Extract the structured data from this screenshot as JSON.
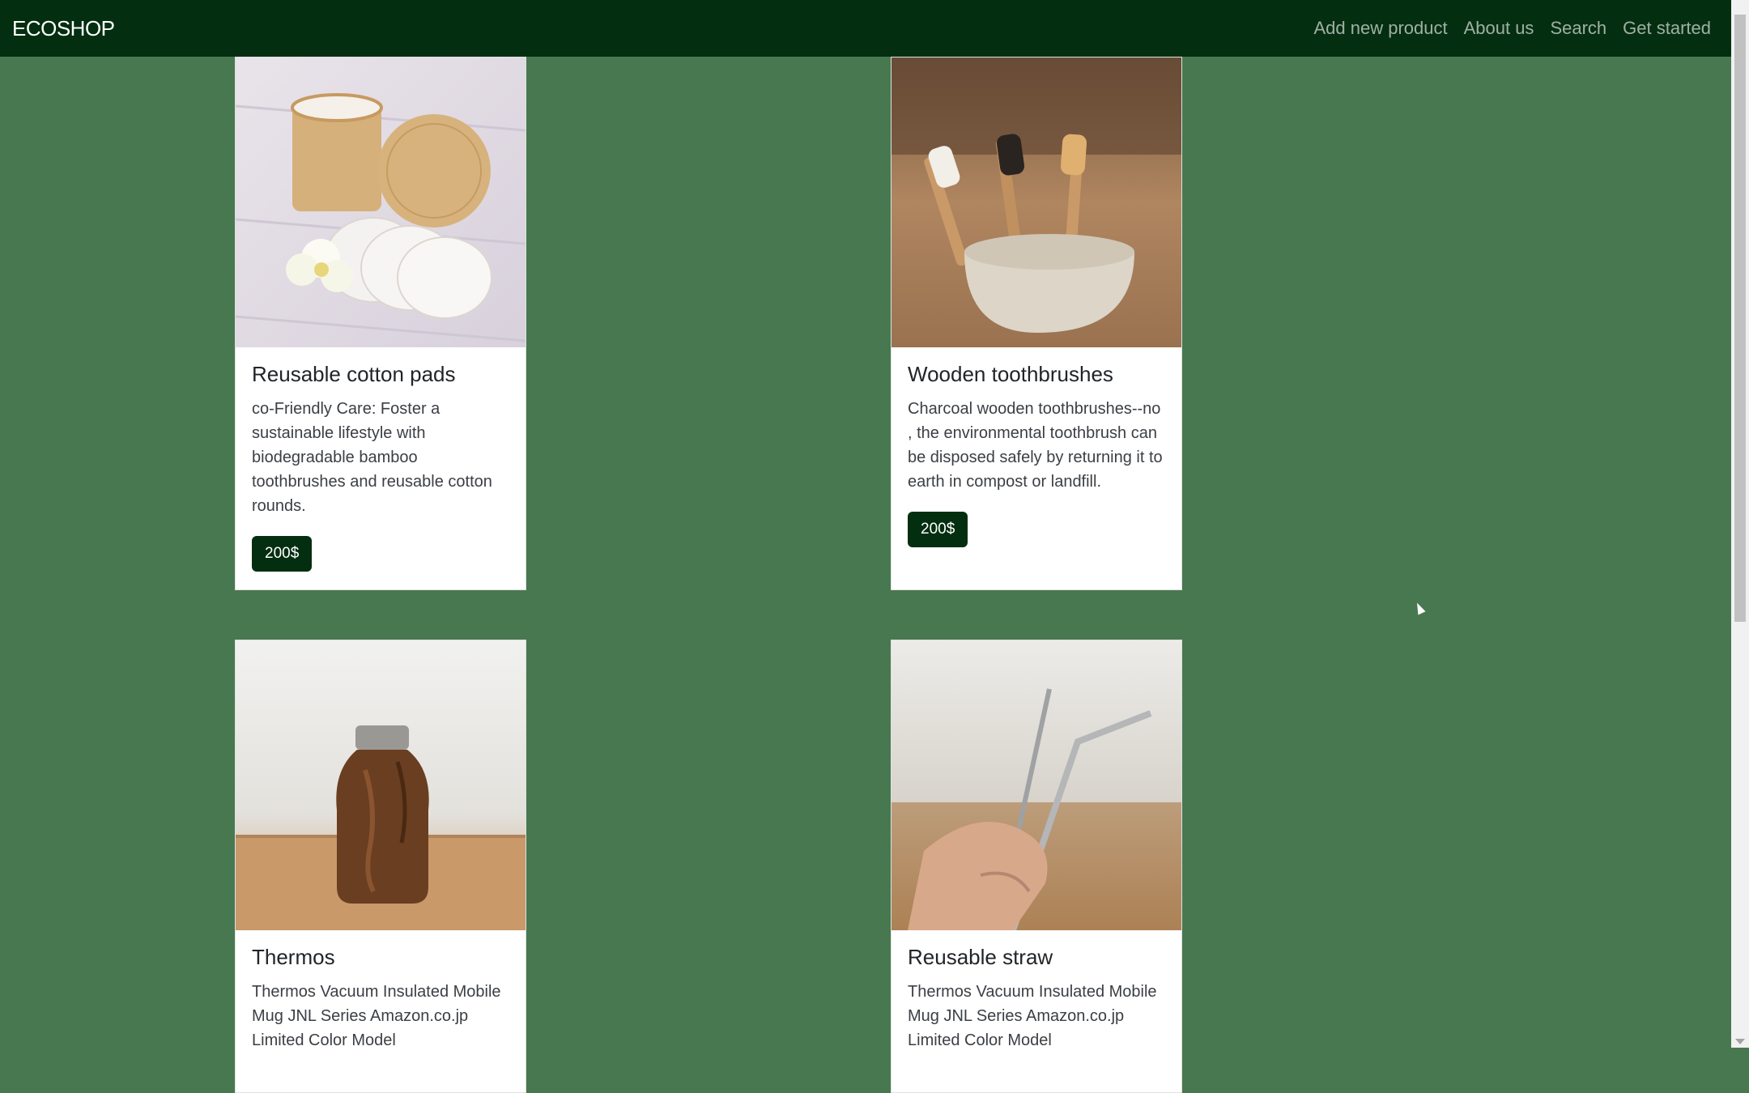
{
  "navbar": {
    "brand": "ECOSHOP",
    "links": [
      "Add new product",
      "About us",
      "Search",
      "Get started"
    ],
    "background": "#032e10"
  },
  "page": {
    "background": "#487850"
  },
  "products": [
    {
      "title": "Reusable cotton pads",
      "description": "co-Friendly Care: Foster a sustainable lifestyle with biodegradable bamboo toothbrushes and reusable cotton rounds.",
      "price": "200$",
      "image_icon": "cotton-pads-image"
    },
    {
      "title": "Wooden toothbrushes",
      "description": "Charcoal wooden toothbrushes--no , the environmental toothbrush can be disposed safely by returning it to earth in compost or landfill.",
      "price": "200$",
      "image_icon": "toothbrush-image"
    },
    {
      "title": "Thermos",
      "description": "Thermos Vacuum Insulated Mobile Mug JNL Series Amazon.co.jp Limited Color Model",
      "price": "",
      "image_icon": "thermos-image"
    },
    {
      "title": "Reusable straw",
      "description": "Thermos Vacuum Insulated Mobile Mug JNL Series Amazon.co.jp Limited Color Model",
      "price": "",
      "image_icon": "straw-image"
    }
  ]
}
